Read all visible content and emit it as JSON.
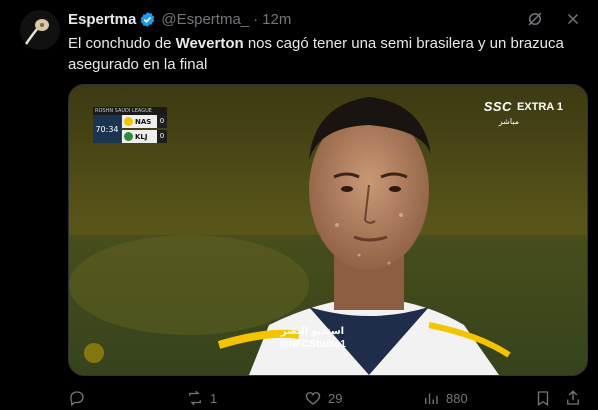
{
  "tweet": {
    "display_name": "Espertma",
    "handle": "@Espertma_",
    "separator": "·",
    "time": "12m",
    "text_before": "El conchudo de ",
    "text_bold": "Weverton",
    "text_after": " nos cagó tener una semi brasilera y un brazuca asegurado en la final"
  },
  "media": {
    "scorebug": {
      "header": "ROSHN SAUDI LEAGUE",
      "clock": "70:34",
      "teams": [
        {
          "name": "NAS",
          "score": "0",
          "color": "#f5c400"
        },
        {
          "name": "KLJ",
          "score": "0",
          "color": "#2e8b3a"
        }
      ]
    },
    "channel_logo": "SSC",
    "channel_name": "EXTRA 1",
    "live_label": "مباشر",
    "watermark_line1": "استديو النصر",
    "watermark_line2": "@NFCStudio1"
  },
  "actions": {
    "reply_count": "",
    "retweet_count": "1",
    "like_count": "29",
    "views_count": "880"
  },
  "colors": {
    "background": "#000000",
    "text": "#e7e9ea",
    "muted": "#71767b",
    "verified": "#1d9bf0"
  }
}
